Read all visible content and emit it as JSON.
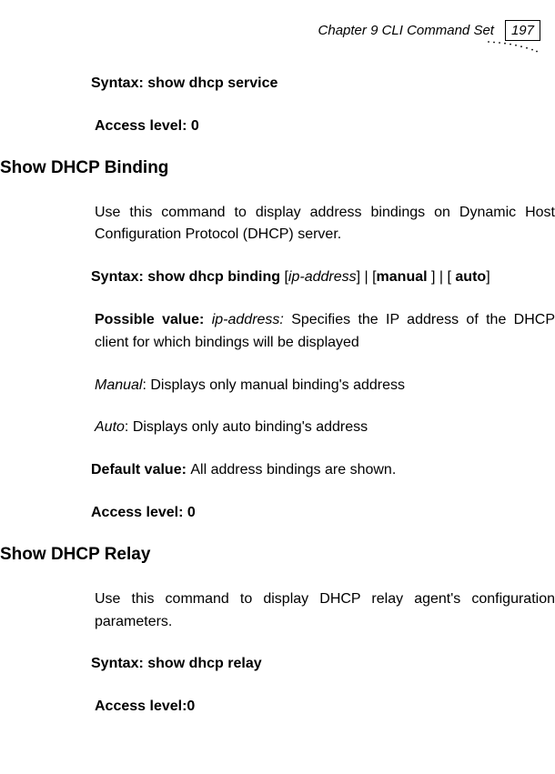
{
  "header": {
    "chapter": "Chapter 9 CLI Command Set",
    "page_number": "197"
  },
  "section1": {
    "syntax_label": "Syntax: show dhcp service",
    "access_label": "Access level: 0"
  },
  "section2": {
    "heading": "Show DHCP Binding",
    "desc": "Use this command to display address bindings on Dynamic Host Configuration Protocol (DHCP) server.",
    "syntax_prefix": "Syntax:  show dhcp binding ",
    "syntax_ip": "ip-address",
    "syntax_mid1": "[",
    "syntax_close1": "] | [",
    "syntax_manual": "manual ",
    "syntax_close2": "] | [ ",
    "syntax_auto": "auto",
    "syntax_close3": "]",
    "possible_label": "Possible value: ",
    "possible_ip": "ip-address:",
    "possible_rest": " Specifies the IP address of the DHCP client for which bindings will be displayed",
    "manual_label": "Manual",
    "manual_rest": ":  Displays only manual binding's address",
    "auto_label": "Auto",
    "auto_rest": ":  Displays only auto binding's address",
    "default_label": "Default value: ",
    "default_rest": "All address bindings are shown.",
    "access_label": "Access level: 0"
  },
  "section3": {
    "heading": "Show DHCP Relay",
    "desc": "Use this command to display DHCP relay agent's configuration parameters.",
    "syntax_label": "Syntax: show dhcp relay",
    "access_label": "Access level:0"
  }
}
